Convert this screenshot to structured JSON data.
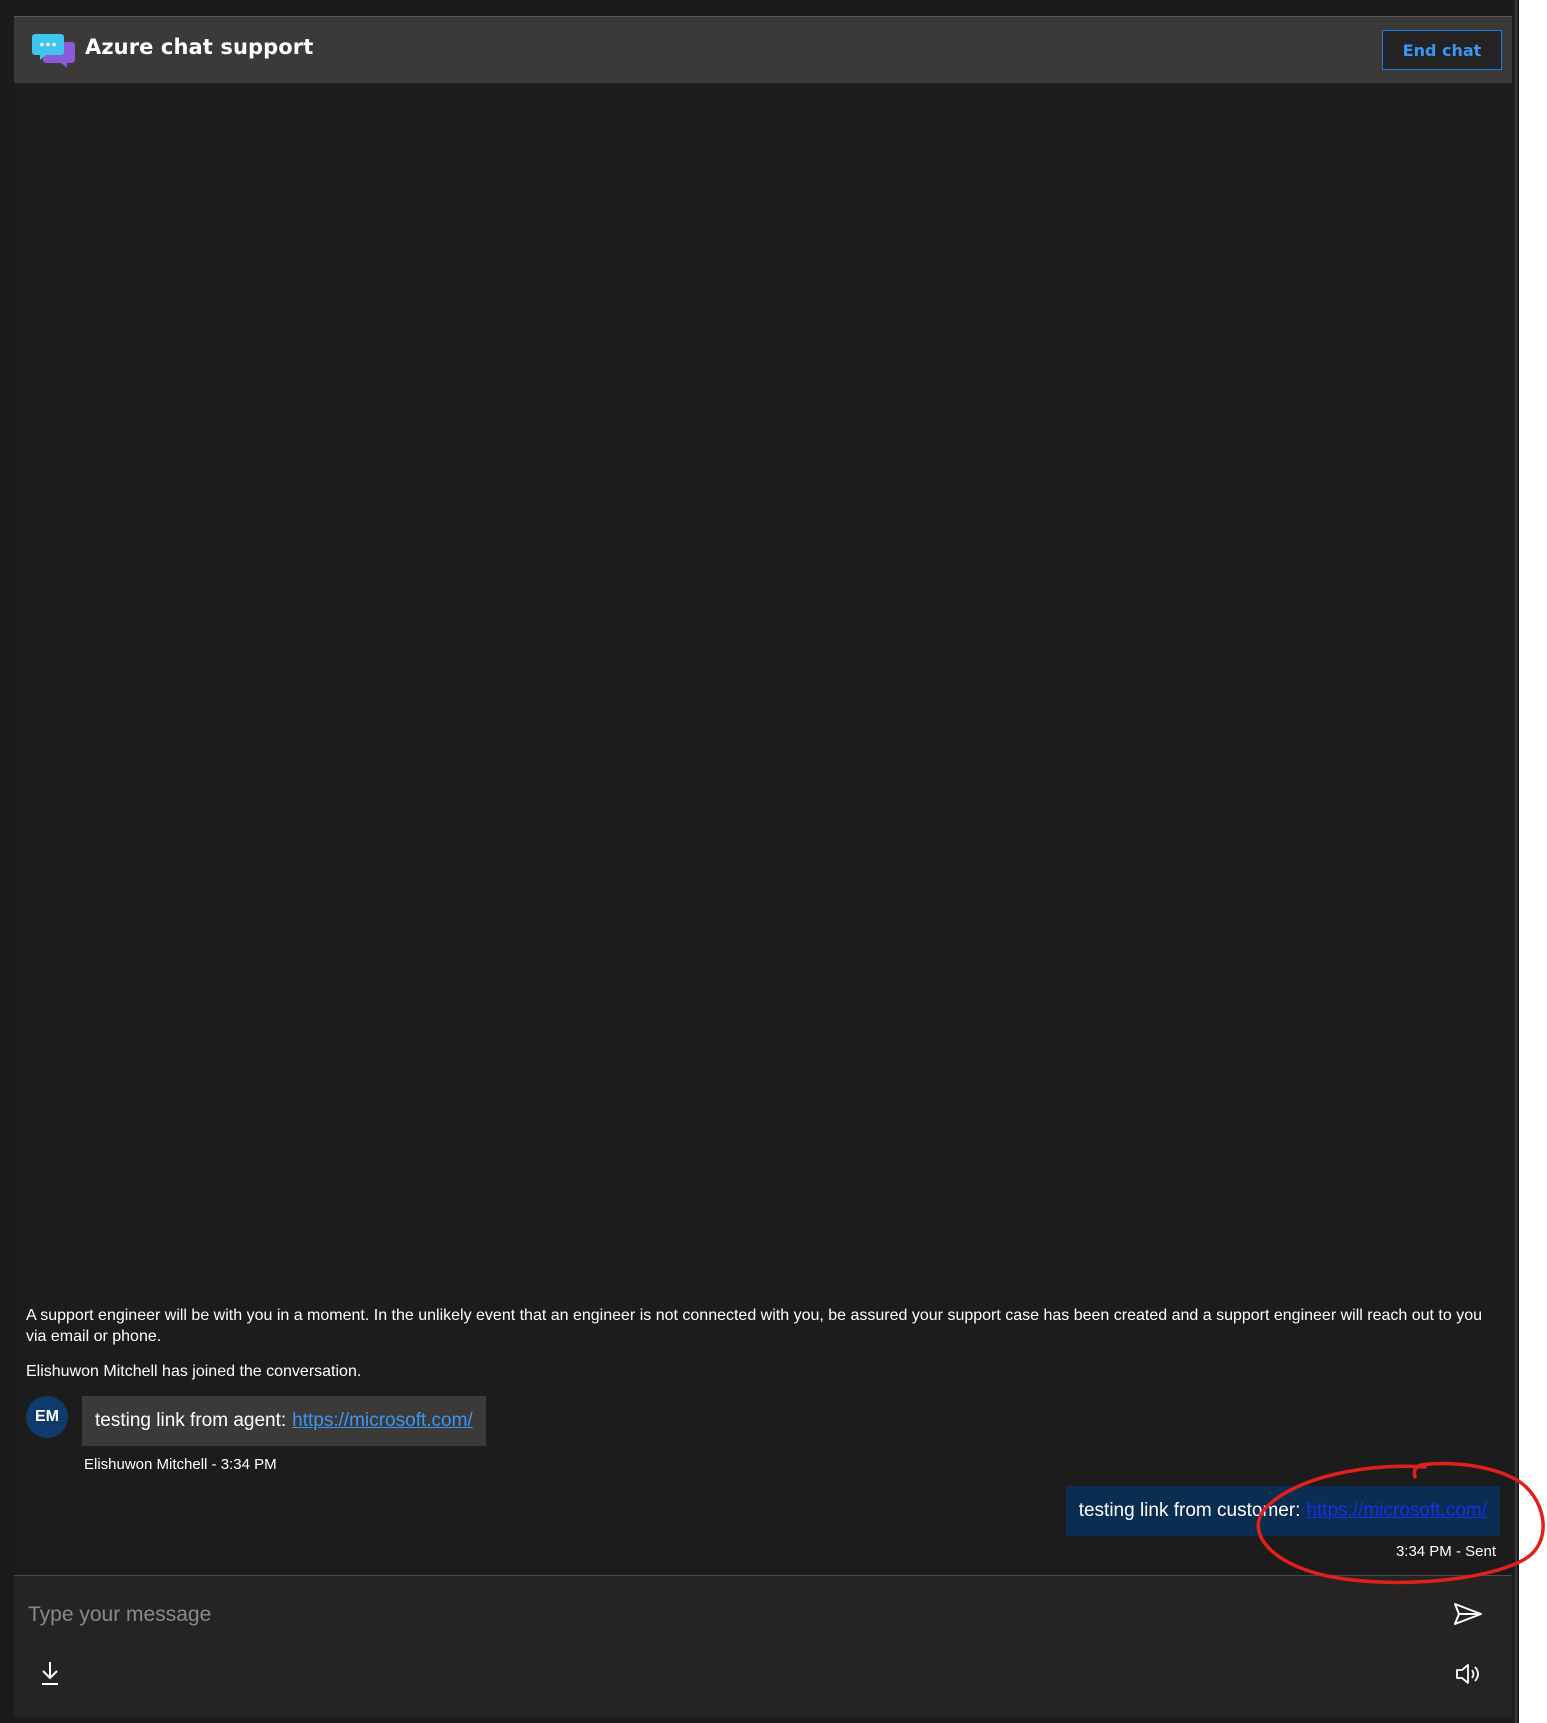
{
  "header": {
    "title": "Azure chat support",
    "end_chat_label": "End chat",
    "icon": "chat-bubbles-icon"
  },
  "messages": {
    "system_notice": "A support engineer will be with you in a moment. In the unlikely event that an engineer is not connected with you, be assured your support case has been created and a support engineer will reach out to you via email or phone.",
    "join_notice": "Elishuwon Mitchell has joined the conversation.",
    "agent": {
      "initials": "EM",
      "text": "testing link from agent:",
      "link": "https://microsoft.com/",
      "meta": "Elishuwon Mitchell - 3:34 PM"
    },
    "customer": {
      "text": "testing link from customer:",
      "link": "https://microsoft.com/",
      "meta": "3:34 PM - Sent"
    }
  },
  "composer": {
    "placeholder": "Type your message",
    "value": "",
    "send_icon": "send-icon",
    "download_icon": "download-icon",
    "sound_icon": "speaker-icon"
  },
  "colors": {
    "background": "#1c1c1c",
    "header": "#3b3a39",
    "accent": "#3a96f5",
    "agent_bubble": "#3b3a39",
    "customer_bubble": "#0b2d52",
    "avatar": "#0e3b6b",
    "annotation": "#e0201b"
  }
}
